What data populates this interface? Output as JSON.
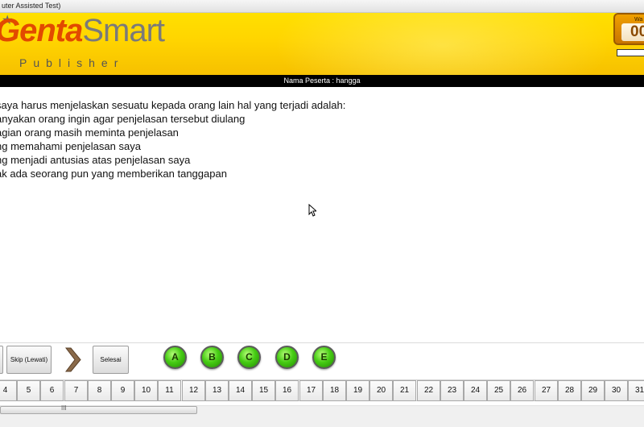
{
  "window": {
    "title": "uter Assisted Test)"
  },
  "header": {
    "logo_part1": "Genta",
    "logo_part2": "Smart",
    "logo_sub": "Publisher",
    "timer_label": "Wa",
    "timer_value": "00",
    "colors": {
      "banner": "#ffd400",
      "logo_orange": "#e24a00",
      "logo_grey": "#7a7a7a",
      "timer": "#f0a000"
    }
  },
  "participant": {
    "label": "Nama Peserta : hangga"
  },
  "question": {
    "stem": "saya harus menjelaskan sesuatu kepada orang lain hal yang terjadi adalah:",
    "options": [
      "anyakan orang ingin agar penjelasan tersebut diulang",
      "agian orang masih meminta penjelasan",
      "ng memahami penjelasan saya",
      "ng menjadi antusias atas penjelasan saya",
      "ak ada seorang pun yang memberikan tanggapan"
    ]
  },
  "nav": {
    "skip_label": "Skip (Lewati)",
    "next_icon": "chevron-right-icon",
    "finish_label": "Selesai"
  },
  "answers": [
    "A",
    "B",
    "C",
    "D",
    "E"
  ],
  "question_numbers": [
    "4",
    "5",
    "6",
    "7",
    "8",
    "9",
    "10",
    "11",
    "12",
    "13",
    "14",
    "15",
    "16",
    "17",
    "18",
    "19",
    "20",
    "21",
    "22",
    "23",
    "24",
    "25",
    "26",
    "27",
    "28",
    "29",
    "30",
    "31"
  ],
  "scrollbar": {
    "grip": "III"
  }
}
